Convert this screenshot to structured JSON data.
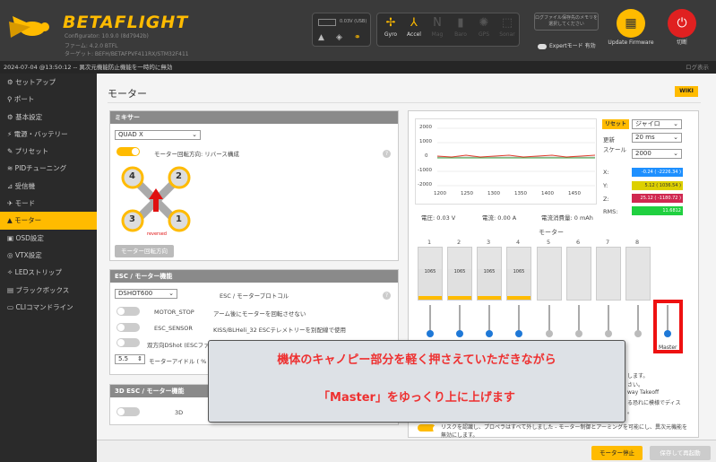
{
  "header": {
    "brand": "BETAFLIGHT",
    "config_line": "Configurator: 10.9.0 (8d7942b)",
    "firmware_line": "ファーム: 4.2.0 BTFL",
    "target_line": "ターゲット: BEFH/BETAFPVF411RX/STM32F411",
    "battery_voltage": "0.03V (USB)",
    "sensors": [
      {
        "label": "Gyro",
        "active": true,
        "icon": "gyro-icon"
      },
      {
        "label": "Accel",
        "active": true,
        "icon": "accel-icon"
      },
      {
        "label": "Mag",
        "active": false,
        "icon": "mag-icon"
      },
      {
        "label": "Baro",
        "active": false,
        "icon": "baro-icon"
      },
      {
        "label": "GPS",
        "active": false,
        "icon": "gps-icon"
      },
      {
        "label": "Sonar",
        "active": false,
        "icon": "sonar-icon"
      }
    ],
    "log_button": "ログファイル保存先のメモリを選択してください",
    "expert_mode": "Expertモード 有効",
    "update_firmware": "Update Firmware",
    "disconnect": "切断"
  },
  "status_bar": {
    "message": "2024-07-04 @13:50:12 -- 異次元機能防止機能を一時的に無効",
    "right": "ログ表示"
  },
  "sidebar": {
    "items": [
      {
        "label": "セットアップ",
        "active": false
      },
      {
        "label": "ポート",
        "active": false
      },
      {
        "label": "基本設定",
        "active": false
      },
      {
        "label": "電源・バッテリー",
        "active": false
      },
      {
        "label": "プリセット",
        "active": false
      },
      {
        "label": "PIDチューニング",
        "active": false
      },
      {
        "label": "受信機",
        "active": false
      },
      {
        "label": "モード",
        "active": false
      },
      {
        "label": "モーター",
        "active": true
      },
      {
        "label": "OSD設定",
        "active": false
      },
      {
        "label": "VTX設定",
        "active": false
      },
      {
        "label": "LEDストリップ",
        "active": false
      },
      {
        "label": "ブラックボックス",
        "active": false
      },
      {
        "label": "CLIコマンドライン",
        "active": false
      }
    ]
  },
  "page": {
    "title": "モーター",
    "wiki": "WIKI"
  },
  "mixer": {
    "header": "ミキサー",
    "selected": "QUAD X",
    "direction_label": "モーター回転方向: リバース構成",
    "reversed_label": "reversed",
    "motor_order_button": "モーター回転方向",
    "motors": [
      "4",
      "2",
      "3",
      "1"
    ]
  },
  "esc": {
    "header": "ESC / モーター機能",
    "protocol_value": "DSHOT600",
    "protocol_label": "ESC / モータープロトコル",
    "motor_stop": "MOTOR_STOP",
    "motor_stop_desc": "アーム後にモーターを回転させない",
    "esc_sensor": "ESC_SENSOR",
    "esc_sensor_desc": "KISS/BLHeli_32 ESCテレメトリーを別配線で使用",
    "bidir": "双方向DShot (ESCファー",
    "idle_value": "5.5",
    "idle_label": "モーターアイドル ( %"
  },
  "esc3d": {
    "header": "3D ESC / モーター機能",
    "label": "3D"
  },
  "graph": {
    "reset": "リセット",
    "sensor": "ジャイロ",
    "rate_label": "更新",
    "rate_value": "20 ms",
    "scale_label": "スケール",
    "scale_value": "2000",
    "x_label": "X:",
    "x_value": "-0.24 ( -2226.34 )",
    "y_label": "Y:",
    "y_value": "5.12 ( 1036.54 )",
    "z_label": "Z:",
    "z_value": "25.12 ( -1180.72 )",
    "rms_label": "RMS:",
    "rms_value": "11.6812",
    "y_ticks": [
      "2000",
      "1000",
      "0",
      "-1000",
      "-2000"
    ],
    "x_ticks": [
      "1200",
      "1250",
      "1300",
      "1350",
      "1400",
      "1450"
    ]
  },
  "readouts": {
    "voltage": "電圧: 0.03 V",
    "current": "電流: 0.00 A",
    "consumption": "電流消費量: 0 mAh"
  },
  "motors_section": {
    "title": "モーター",
    "numbers": [
      "1",
      "2",
      "3",
      "4",
      "5",
      "6",
      "7",
      "8"
    ],
    "values": [
      "1065",
      "1065",
      "1065",
      "1065"
    ],
    "master_label": "Master"
  },
  "notice": {
    "lines": [
      "します。",
      "さい。",
      "way Takeoff",
      "る恐れに模様でディス",
      "。"
    ],
    "risk_text": "リスクを認識し、プロペラはすべて外しました - モーター制御とアーミングを可能にし、異次元機能を無効にします。"
  },
  "callout": {
    "line1": "機体のキャノピー部分を軽く押さえていただきながら",
    "line2": "「Master」をゆっくり上に上げます"
  },
  "footer": {
    "stop_button": "モーター停止",
    "save_button": "保存して再起動"
  },
  "colors": {
    "accent": "#ffbb00",
    "callout_text": "#ee3030",
    "highlight": "#ee1111"
  }
}
